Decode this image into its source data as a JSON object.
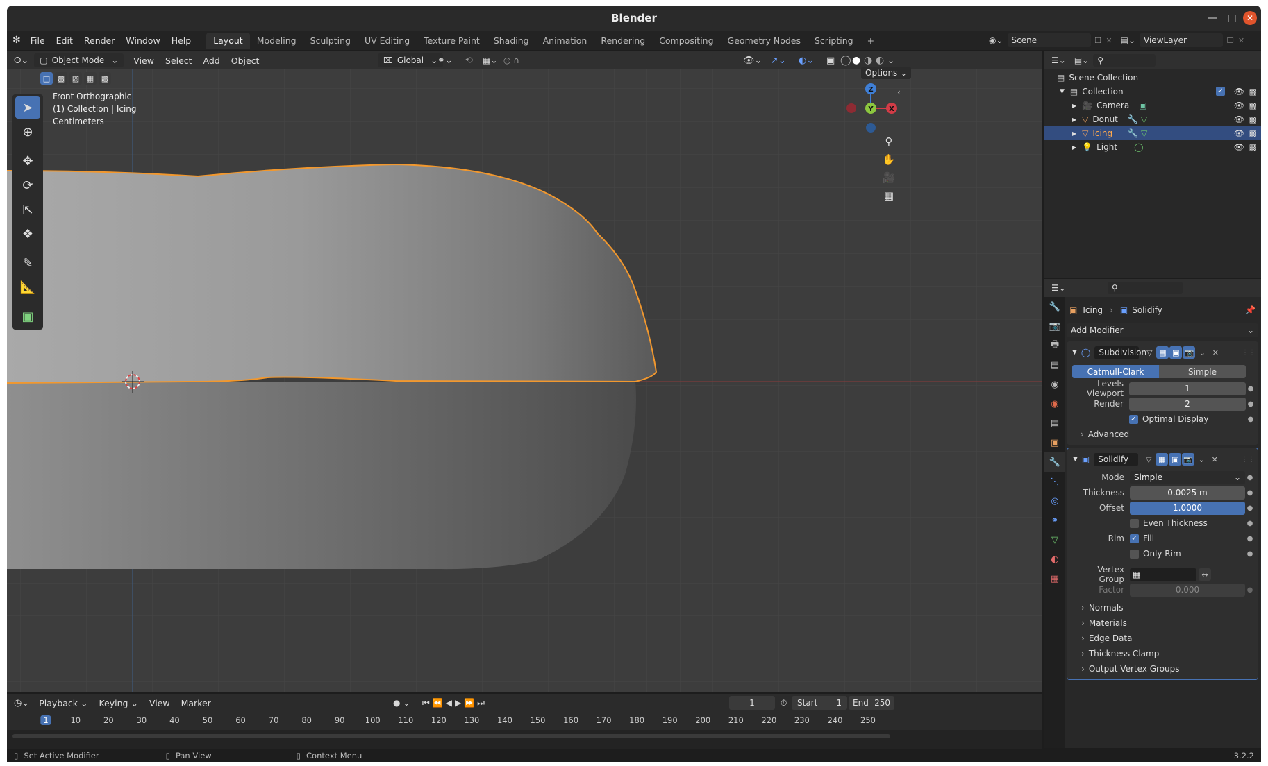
{
  "window": {
    "title": "Blender",
    "version": "3.2.2"
  },
  "menu": {
    "items": [
      "File",
      "Edit",
      "Render",
      "Window",
      "Help"
    ]
  },
  "workspaces": [
    "Layout",
    "Modeling",
    "Sculpting",
    "UV Editing",
    "Texture Paint",
    "Shading",
    "Animation",
    "Rendering",
    "Compositing",
    "Geometry Nodes",
    "Scripting"
  ],
  "active_workspace": "Layout",
  "scene": {
    "name": "Scene",
    "view_layer": "ViewLayer"
  },
  "viewport": {
    "mode": "Object Mode",
    "menus": [
      "View",
      "Select",
      "Add",
      "Object"
    ],
    "orientation": "Global",
    "options_label": "Options",
    "overlay": {
      "view_name": "Front Orthographic",
      "collection": "(1) Collection | Icing",
      "units": "Centimeters"
    },
    "gizmo": {
      "z": "Z",
      "y": "Y",
      "x": "X"
    }
  },
  "outliner": {
    "root": "Scene Collection",
    "collection": "Collection",
    "items": [
      {
        "name": "Camera",
        "selected": false
      },
      {
        "name": "Donut",
        "selected": false
      },
      {
        "name": "Icing",
        "selected": true
      },
      {
        "name": "Light",
        "selected": false
      }
    ]
  },
  "properties": {
    "breadcrumb_object": "Icing",
    "breadcrumb_modifier": "Solidify",
    "add_modifier": "Add Modifier",
    "subdivision": {
      "name": "Subdivision",
      "type_a": "Catmull-Clark",
      "type_b": "Simple",
      "levels_viewport_label": "Levels Viewport",
      "levels_viewport": "1",
      "render_label": "Render",
      "render": "2",
      "optimal_display": "Optimal Display",
      "advanced": "Advanced"
    },
    "solidify": {
      "name": "Solidify",
      "mode_label": "Mode",
      "mode": "Simple",
      "thickness_label": "Thickness",
      "thickness": "0.0025 m",
      "offset_label": "Offset",
      "offset": "1.0000",
      "even_thickness": "Even Thickness",
      "rim_label": "Rim",
      "fill": "Fill",
      "only_rim": "Only Rim",
      "vertex_group_label": "Vertex Group",
      "factor_label": "Factor",
      "factor": "0.000",
      "subpanels": [
        "Normals",
        "Materials",
        "Edge Data",
        "Thickness Clamp",
        "Output Vertex Groups"
      ]
    }
  },
  "timeline": {
    "menus": [
      "Playback",
      "Keying",
      "View",
      "Marker"
    ],
    "current_frame": "1",
    "start_label": "Start",
    "start": "1",
    "end_label": "End",
    "end": "250",
    "ruler": [
      "1",
      "10",
      "20",
      "30",
      "40",
      "50",
      "60",
      "70",
      "80",
      "90",
      "100",
      "110",
      "120",
      "130",
      "140",
      "150",
      "160",
      "170",
      "180",
      "190",
      "200",
      "210",
      "220",
      "230",
      "240",
      "250"
    ]
  },
  "status": {
    "left": "Set Active Modifier",
    "middle": "Pan View",
    "right": "Context Menu"
  }
}
